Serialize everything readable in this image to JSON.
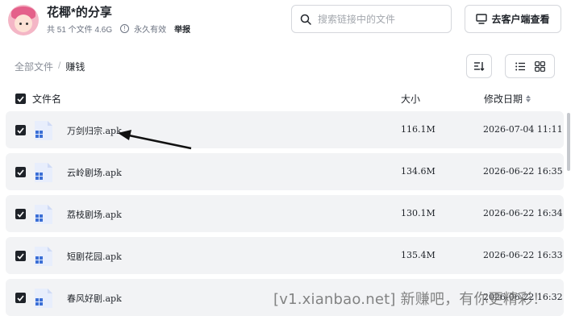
{
  "header": {
    "title": "花椰*的分享",
    "file_count": "共 51 个文件 4.6G",
    "validity": "永久有效",
    "report_label": "举报",
    "info_icon": "info-icon"
  },
  "search": {
    "placeholder": "搜索链接中的文件",
    "value": ""
  },
  "client_button": {
    "label": "去客户端查看",
    "icon": "monitor-icon"
  },
  "breadcrumb": {
    "root": "全部文件",
    "separator": "/",
    "current": "赚钱"
  },
  "toolbar": {
    "sort_icon": "sort-icon",
    "list_icon": "list-view-icon",
    "grid_icon": "grid-view-icon"
  },
  "table": {
    "columns": {
      "name": "文件名",
      "size": "大小",
      "date": "修改日期"
    },
    "rows": [
      {
        "name": "万剑归宗.apk",
        "size": "116.1M",
        "date": "2026-07-04 11:11"
      },
      {
        "name": "云岭剧场.apk",
        "size": "134.6M",
        "date": "2026-06-22 16:35"
      },
      {
        "name": "荔枝剧场.apk",
        "size": "130.1M",
        "date": "2026-06-22 16:34"
      },
      {
        "name": "短剧花园.apk",
        "size": "135.4M",
        "date": "2026-06-22 16:33"
      },
      {
        "name": "春风好剧.apk",
        "size": "",
        "date": "2026-06-22 16:32"
      }
    ]
  },
  "watermark": "[v1.xianbao.net] 新赚吧，有你更精彩！",
  "colors": {
    "row_bg": "#f2f3f5",
    "checkbox": "#1f2329",
    "apk_icon": "#3b6fd6"
  }
}
